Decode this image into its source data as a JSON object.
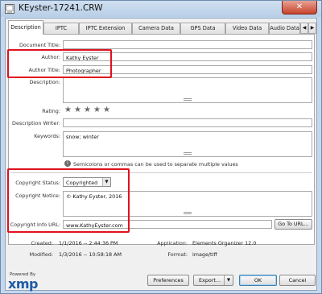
{
  "window": {
    "title": "KEyster-17241.CRW",
    "close_label": "✕"
  },
  "tabs": {
    "items": [
      {
        "label": "Description"
      },
      {
        "label": "IPTC"
      },
      {
        "label": "IPTC Extension"
      },
      {
        "label": "Camera Data"
      },
      {
        "label": "GPS Data"
      },
      {
        "label": "Video Data"
      },
      {
        "label": "Audio Data"
      }
    ],
    "scroll_left": "◀",
    "scroll_right": "▶"
  },
  "description": {
    "document_title": {
      "label": "Document Title:",
      "value": ""
    },
    "author": {
      "label": "Author:",
      "value": "Kathy Eyster"
    },
    "author_title": {
      "label": "Author Title:",
      "value": "Photographer"
    },
    "description_field": {
      "label": "Description:",
      "value": ""
    },
    "rating": {
      "label": "Rating:",
      "stars": 5,
      "filled": 0,
      "star_glyph": "★"
    },
    "description_writer": {
      "label": "Description Writer:",
      "value": ""
    },
    "keywords": {
      "label": "Keywords:",
      "value": "snow; winter"
    },
    "keywords_hint": "Semicolons or commas can be used to separate multiple values",
    "copyright_status": {
      "label": "Copyright Status:",
      "value": "Copyrighted"
    },
    "copyright_notice": {
      "label": "Copyright Notice:",
      "value": "© Kathy Eyster, 2016"
    },
    "copyright_url": {
      "label": "Copyright Info URL:",
      "value": "www.KathyEyster.com"
    },
    "goto_url_button": "Go To URL..."
  },
  "metadata": {
    "created": {
      "label": "Created:",
      "value": "1/1/2016 -- 2:44:36 PM"
    },
    "modified": {
      "label": "Modified:",
      "value": "1/3/2016 -- 10:58:18 AM"
    },
    "application": {
      "label": "Application:",
      "value": "Elements Organizer 12.0"
    },
    "format": {
      "label": "Format:",
      "value": "image/tiff"
    }
  },
  "footer": {
    "powered_by": "Powered By",
    "xmp_logo": "xmp",
    "preferences_button": "Preferences",
    "export_button": "Export...",
    "ok_button": "OK",
    "cancel_button": "Cancel"
  },
  "icons": {
    "info_icon": "i",
    "dropdown_arrow": "▼"
  },
  "colors": {
    "highlight_box": "#e0111e",
    "xmp_blue": "#1f5aa6"
  }
}
